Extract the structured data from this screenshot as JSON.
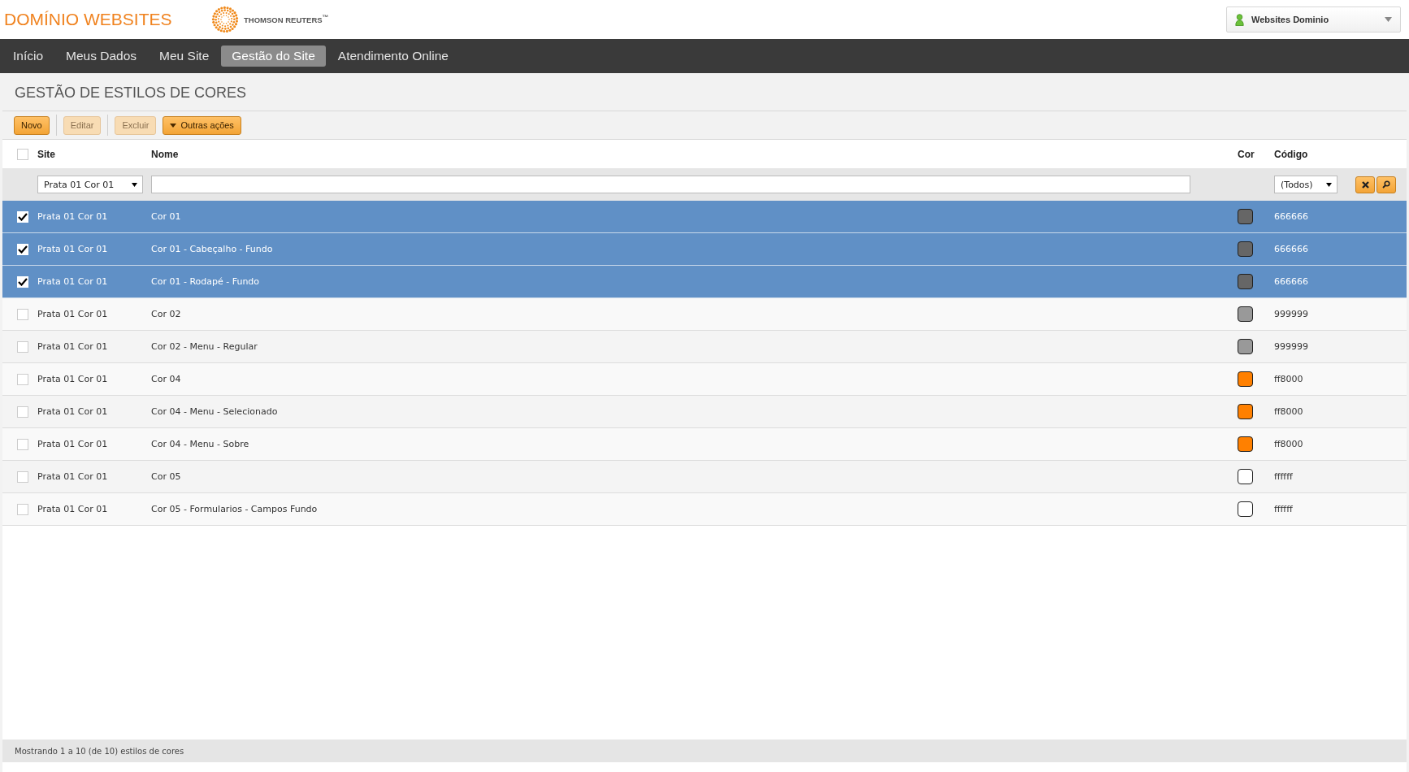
{
  "header": {
    "brand": "DOMÍNIO WEBSITES",
    "partner_logo": "THOMSON REUTERS$^{™}$",
    "user_menu": "Websites Dominio"
  },
  "nav": [
    {
      "label": "Início",
      "selected": false
    },
    {
      "label": "Meus Dados",
      "selected": false
    },
    {
      "label": "Meu Site",
      "selected": false
    },
    {
      "label": "Gestão do Site",
      "selected": true
    },
    {
      "label": "Atendimento Online",
      "selected": false
    }
  ],
  "page_title": "GESTÃO DE ESTILOS DE CORES",
  "toolbar": [
    {
      "label": "Novo",
      "disabled": false,
      "kind": "button"
    },
    {
      "label": "Editar",
      "disabled": true,
      "kind": "button"
    },
    {
      "label": "Excluir",
      "disabled": true,
      "kind": "button"
    },
    {
      "label": "Outras ações",
      "disabled": false,
      "kind": "dropdown"
    }
  ],
  "table": {
    "select_all_checked": false,
    "columns": [
      "Site",
      "Nome",
      "Cor",
      "Código"
    ],
    "filters": {
      "site": "Prata 01 Cor 01",
      "codigo": "(Todos)"
    },
    "rows": [
      {
        "site": "Prata 01 Cor 01",
        "name": "Cor 01",
        "color": "#666666",
        "code": "666666",
        "selected": true
      },
      {
        "site": "Prata 01 Cor 01",
        "name": "Cor 01 - Cabeçalho - Fundo",
        "color": "#666666",
        "code": "666666",
        "selected": true
      },
      {
        "site": "Prata 01 Cor 01",
        "name": "Cor 01 - Rodapé - Fundo",
        "color": "#666666",
        "code": "666666",
        "selected": true
      },
      {
        "site": "Prata 01 Cor 01",
        "name": "Cor 02",
        "color": "#999999",
        "code": "999999",
        "selected": false
      },
      {
        "site": "Prata 01 Cor 01",
        "name": "Cor 02 - Menu - Regular",
        "color": "#999999",
        "code": "999999",
        "selected": false
      },
      {
        "site": "Prata 01 Cor 01",
        "name": "Cor 04",
        "color": "#ff8000",
        "code": "ff8000",
        "selected": false
      },
      {
        "site": "Prata 01 Cor 01",
        "name": "Cor 04 - Menu - Selecionado",
        "color": "#ff8000",
        "code": "ff8000",
        "selected": false
      },
      {
        "site": "Prata 01 Cor 01",
        "name": "Cor 04 - Menu - Sobre",
        "color": "#ff8000",
        "code": "ff8000",
        "selected": false
      },
      {
        "site": "Prata 01 Cor 01",
        "name": "Cor 05",
        "color": "#ffffff",
        "code": "ffffff",
        "selected": false
      },
      {
        "site": "Prata 01 Cor 01",
        "name": "Cor 05 - Formularios - Campos Fundo",
        "color": "#ffffff",
        "code": "ffffff",
        "selected": false
      }
    ]
  },
  "status_bar": "Mostrando 1 a 10 (de 10) estilos de cores"
}
